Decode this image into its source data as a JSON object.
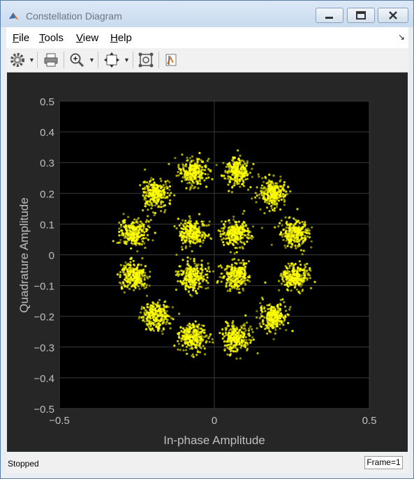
{
  "window": {
    "title": "Constellation Diagram"
  },
  "menu": {
    "items": [
      {
        "label": "File",
        "accel": "F",
        "rest": "ile"
      },
      {
        "label": "Tools",
        "accel": "T",
        "rest": "ools"
      },
      {
        "label": "View",
        "accel": "V",
        "rest": "iew"
      },
      {
        "label": "Help",
        "accel": "H",
        "rest": "elp"
      }
    ]
  },
  "toolbar": {
    "icons": [
      "gear-icon",
      "print-icon",
      "zoom-in-icon",
      "autoscale-icon",
      "reference-constellation-icon",
      "measurement-icon"
    ]
  },
  "colors": {
    "figure_bg": "#262626",
    "axes_bg": "#000000",
    "points": "#ffff00",
    "axis_text": "#bfbfbf",
    "grid": "#3a3a3a"
  },
  "chart_data": {
    "type": "scatter",
    "xlabel": "In-phase Amplitude",
    "ylabel": "Quadrature Amplitude",
    "xlim": [
      -0.5,
      0.5
    ],
    "ylim": [
      -0.5,
      0.5
    ],
    "xticks": [
      "−0.5",
      "0",
      "0.5"
    ],
    "yticks": [
      "0.5",
      "0.4",
      "0.3",
      "0.2",
      "0.1",
      "0",
      "−0.1",
      "−0.2",
      "−0.3",
      "−0.4",
      "−0.5"
    ],
    "grid": true,
    "series": [
      {
        "cluster_centers": [
          [
            -0.07,
            0.27
          ],
          [
            0.07,
            0.27
          ],
          [
            -0.19,
            0.2
          ],
          [
            0.19,
            0.2
          ],
          [
            -0.26,
            0.07
          ],
          [
            -0.07,
            0.07
          ],
          [
            0.07,
            0.07
          ],
          [
            0.26,
            0.07
          ],
          [
            -0.26,
            -0.07
          ],
          [
            -0.07,
            -0.07
          ],
          [
            0.07,
            -0.07
          ],
          [
            0.26,
            -0.07
          ],
          [
            -0.19,
            -0.2
          ],
          [
            0.19,
            -0.2
          ],
          [
            -0.07,
            -0.27
          ],
          [
            0.07,
            -0.27
          ]
        ],
        "cluster_spread_std": 0.022
      }
    ]
  },
  "status": {
    "text": "Stopped",
    "frame": "Frame=1"
  }
}
